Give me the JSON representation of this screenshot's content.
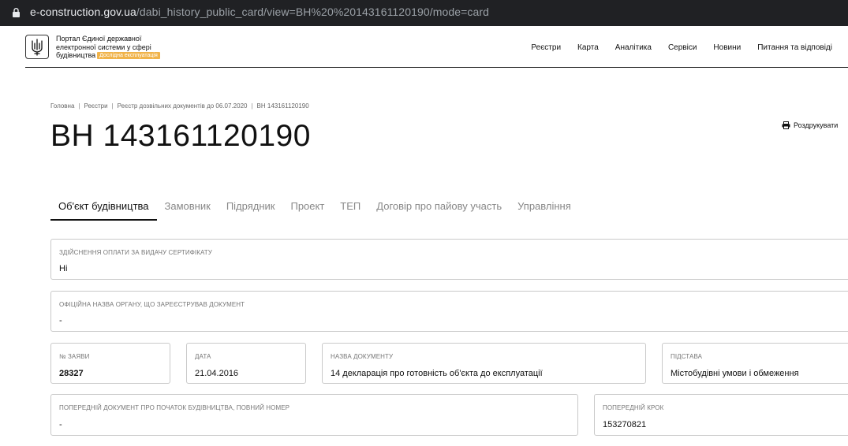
{
  "browser": {
    "url_domain": "e-construction.gov.ua",
    "url_path": "/dabi_history_public_card/view=ВН%20%20143161120190/mode=card"
  },
  "header": {
    "title_lines": [
      "Портал Єдиної державної",
      "електронної системи у сфері",
      "будівництва"
    ],
    "badge": "Дослідна експлуатація",
    "nav": [
      "Реєстри",
      "Карта",
      "Аналітика",
      "Сервіси",
      "Новини",
      "Питання та відповіді"
    ]
  },
  "breadcrumbs": [
    "Головна",
    "Реєстри",
    "Реєстр дозвільних документів до 06.07.2020",
    "ВН 143161120190"
  ],
  "page_title": "ВН 143161120190",
  "print_label": "Роздрукувати",
  "tabs": [
    "Об'єкт будівництва",
    "Замовник",
    "Підрядник",
    "Проект",
    "ТЕП",
    "Договір про пайову участь",
    "Управління"
  ],
  "fields": {
    "payment": {
      "label": "Здійснення оплати за видачу сертифікату",
      "value": "Ні"
    },
    "authority": {
      "label": "Офіційна назва органу, що зареєстрував документ",
      "value": "-"
    },
    "app_number": {
      "label": "№ заяви",
      "value": "28327"
    },
    "date": {
      "label": "Дата",
      "value": "21.04.2016"
    },
    "doc_name": {
      "label": "Назва документу",
      "value": "14 декларація про готовність об'єкта до експлуатації"
    },
    "basis": {
      "label": "Підстава",
      "value": "Містобудівні умови і обмеження"
    },
    "prev_doc": {
      "label": "Попередній документ про початок будівництва, повний номер",
      "value": "-"
    },
    "prev_step": {
      "label": "Попередній крок",
      "value": "153270821"
    }
  }
}
